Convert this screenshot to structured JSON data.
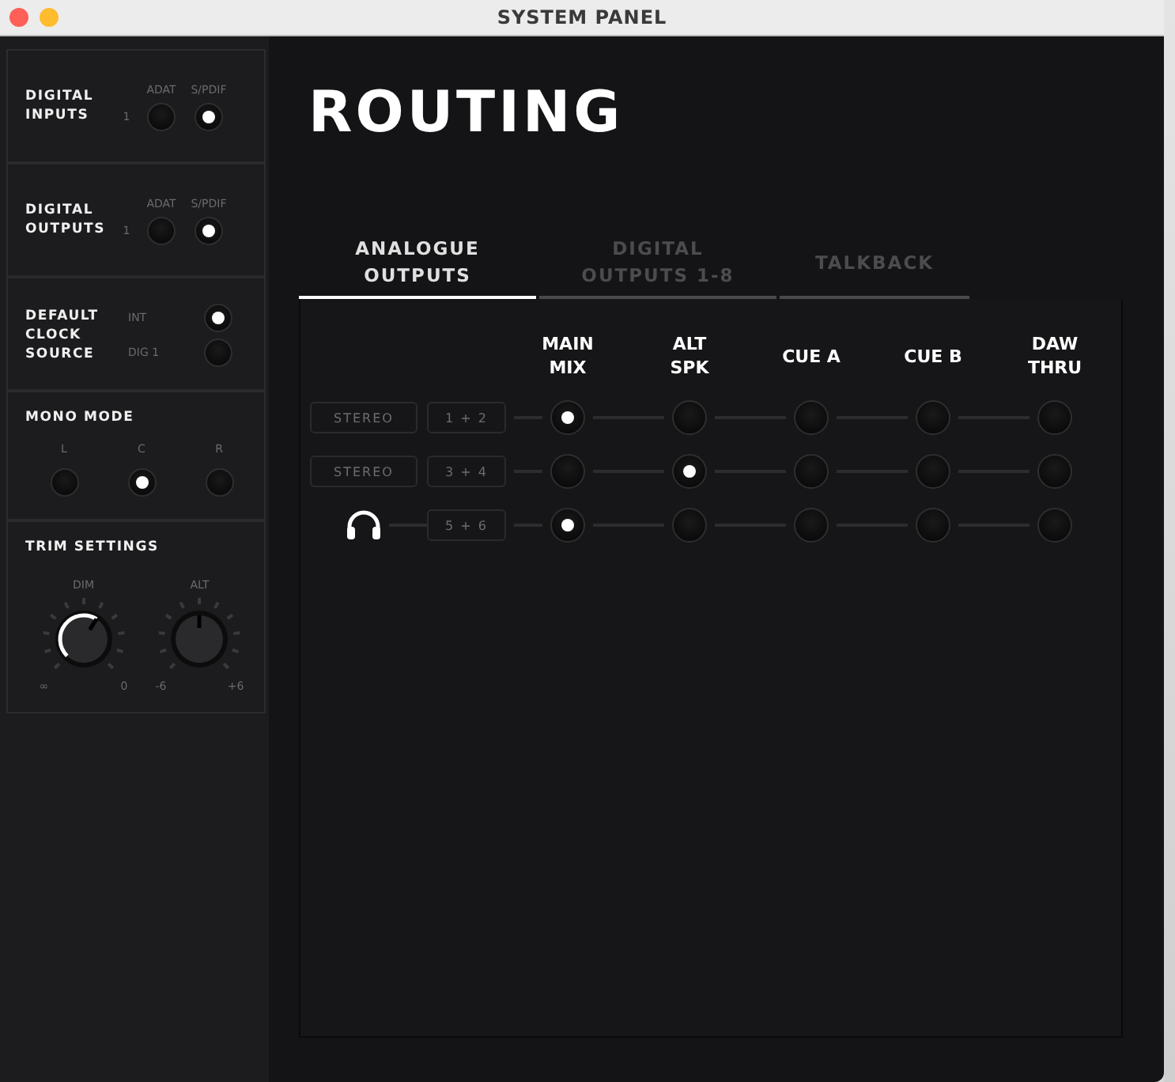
{
  "window": {
    "title": "SYSTEM PANEL"
  },
  "sidebar": {
    "sections": [
      {
        "kind": "pair",
        "title": "DIGITAL INPUTS",
        "row_label": "1",
        "options": [
          {
            "label": "ADAT",
            "selected": false
          },
          {
            "label": "S/PDIF",
            "selected": true
          }
        ]
      },
      {
        "kind": "pair",
        "title": "DIGITAL OUTPUTS",
        "row_label": "1",
        "options": [
          {
            "label": "ADAT",
            "selected": false
          },
          {
            "label": "S/PDIF",
            "selected": true
          }
        ]
      },
      {
        "kind": "list",
        "title": "DEFAULT CLOCK SOURCE",
        "options": [
          {
            "label": "INT",
            "selected": true
          },
          {
            "label": "DIG 1",
            "selected": false
          }
        ]
      },
      {
        "kind": "row",
        "title": "MONO MODE",
        "options": [
          {
            "label": "L",
            "selected": false
          },
          {
            "label": "C",
            "selected": true
          },
          {
            "label": "R",
            "selected": false
          }
        ]
      },
      {
        "kind": "knobs",
        "title": "TRIM SETTINGS",
        "knobs": [
          {
            "kind": "unipolar",
            "label": "DIM",
            "min": "∞",
            "max": "0"
          },
          {
            "kind": "bipolar",
            "label": "ALT",
            "min": "-6",
            "max": "+6"
          }
        ]
      }
    ]
  },
  "main": {
    "title": "ROUTING",
    "tabs": [
      {
        "label": "ANALOGUE OUTPUTS",
        "selected": true
      },
      {
        "label": "DIGITAL OUTPUTS 1-8",
        "selected": false
      },
      {
        "label": "TALKBACK",
        "selected": false
      }
    ],
    "routing": {
      "columns": [
        "MAIN MIX",
        "ALT SPK",
        "CUE A",
        "CUE B",
        "DAW THRU"
      ],
      "rows": [
        {
          "kind": "stereo",
          "mode": "STEREO",
          "channels": "1 + 2",
          "routes": [
            {
              "selected": true
            },
            {
              "selected": false
            },
            {
              "selected": false
            },
            {
              "selected": false
            },
            {
              "selected": false
            }
          ]
        },
        {
          "kind": "stereo",
          "mode": "STEREO",
          "channels": "3 + 4",
          "routes": [
            {
              "selected": false
            },
            {
              "selected": true
            },
            {
              "selected": false
            },
            {
              "selected": false
            },
            {
              "selected": false
            }
          ]
        },
        {
          "kind": "headphones",
          "channels": "5 + 6",
          "routes": [
            {
              "selected": true
            },
            {
              "selected": false
            },
            {
              "selected": false
            },
            {
              "selected": false
            },
            {
              "selected": false
            }
          ]
        }
      ]
    }
  }
}
